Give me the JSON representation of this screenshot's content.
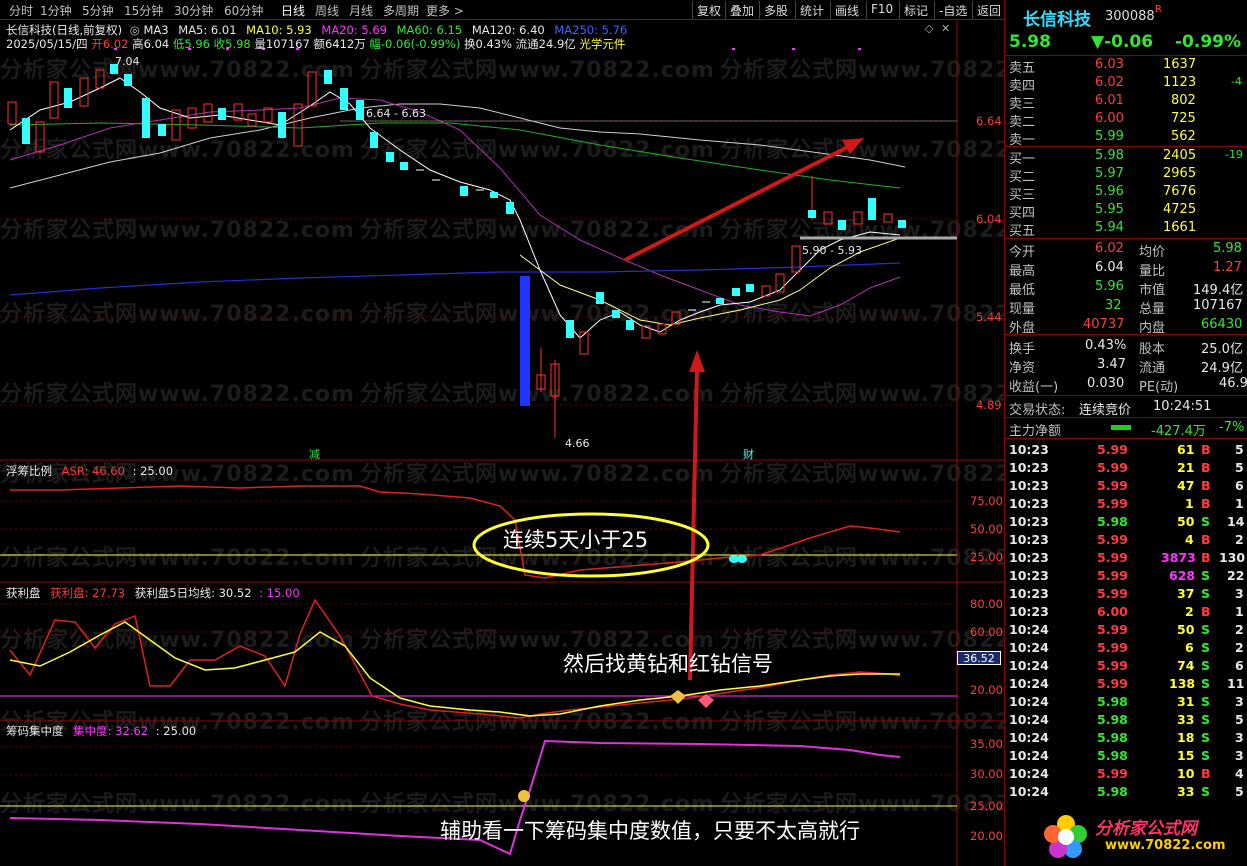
{
  "toolbar": {
    "periods": [
      "分时",
      "1分钟",
      "5分钟",
      "15分钟",
      "30分钟",
      "60分钟",
      "日线",
      "周线",
      "月线",
      "多周期",
      "更多 >"
    ],
    "buttons": [
      "复权",
      "叠加",
      "多股",
      "统计",
      "画线",
      "F10",
      "标记",
      "-自选",
      "返回"
    ]
  },
  "info": {
    "title": "长信科技(日线,前复权)",
    "ma3": "MA3",
    "ma5": "MA5: 6.01",
    "ma10": "MA10: 5.93",
    "ma20": "MA20: 5.69",
    "ma60": "MA60: 6.15",
    "ma120": "MA120: 6.40",
    "ma250": "MA250: 5.76",
    "line2_date": "2025/05/15/四",
    "line2_open": "开6.02",
    "line2_high": "高6.04",
    "line2_low": "低5.96",
    "line2_close": "收5.98",
    "line2_vol": "量107167",
    "line2_amt": "额6412万",
    "line2_chg": "幅-0.06(-0.99%)",
    "line2_turn": "换0.43%",
    "line2_float": "流通24.9亿",
    "line2_sector": "光学元件"
  },
  "price_axis": [
    "6.64",
    "6.04",
    "5.44",
    "4.89"
  ],
  "price_labels": {
    "high": "7.04",
    "low": "4.66",
    "box_top": "6.64 - 6.63",
    "box_right": "5.90 - 5.93",
    "marker_minus": "减",
    "marker_cai": "财"
  },
  "indicator1": {
    "name": "浮筹比例",
    "asr": "ASR: 46.60",
    "line": ": 25.00",
    "axis": [
      "75.00",
      "50.00",
      "25.00"
    ]
  },
  "indicator2": {
    "name": "获利盘",
    "a": "获利盘: 27.73",
    "b": "获利盘5日均线: 30.52",
    "c": ": 15.00",
    "axis": [
      "80.00",
      "60.00",
      "20.00"
    ],
    "cursor_value": "36.52"
  },
  "indicator3": {
    "name": "筹码集中度",
    "a": "集中度: 32.62",
    "b": ": 25.00",
    "axis": [
      "35.00",
      "30.00",
      "25.00",
      "20.00"
    ]
  },
  "annotations": {
    "ellipse_text": "连续5天小于25",
    "signal_text": "然后找黄钻和红钻信号",
    "bottom_text": "辅助看一下筹码集中度数值，只要不太高就行"
  },
  "watermark": "分析家公式网www.70822.com",
  "logo": {
    "name": "分析家公式网",
    "url": "www.70822.com"
  },
  "quote": {
    "name": "长信科技",
    "code": "300088",
    "badge": "R",
    "price": "5.98",
    "change": "▼-0.06",
    "pct": "-0.99%",
    "asks": [
      {
        "label": "卖五",
        "price": "6.03",
        "vol": "1637",
        "delta": ""
      },
      {
        "label": "卖四",
        "price": "6.02",
        "vol": "1123",
        "delta": "-4"
      },
      {
        "label": "卖三",
        "price": "6.01",
        "vol": "802",
        "delta": ""
      },
      {
        "label": "卖二",
        "price": "6.00",
        "vol": "725",
        "delta": ""
      },
      {
        "label": "卖一",
        "price": "5.99",
        "vol": "562",
        "delta": ""
      }
    ],
    "bids": [
      {
        "label": "买一",
        "price": "5.98",
        "vol": "2405",
        "delta": "-19"
      },
      {
        "label": "买二",
        "price": "5.97",
        "vol": "2965",
        "delta": ""
      },
      {
        "label": "买三",
        "price": "5.96",
        "vol": "7676",
        "delta": ""
      },
      {
        "label": "买四",
        "price": "5.95",
        "vol": "4725",
        "delta": ""
      },
      {
        "label": "买五",
        "price": "5.94",
        "vol": "1661",
        "delta": ""
      }
    ],
    "stats": [
      {
        "k1": "今开",
        "v1": "6.02",
        "k2": "均价",
        "v2": "5.98",
        "c1": "red",
        "c2": "green"
      },
      {
        "k1": "最高",
        "v1": "6.04",
        "k2": "量比",
        "v2": "1.27",
        "c1": "white",
        "c2": "red"
      },
      {
        "k1": "最低",
        "v1": "5.96",
        "k2": "市值",
        "v2": "149.4亿",
        "c1": "green",
        "c2": "white"
      },
      {
        "k1": "现量",
        "v1": "32",
        "k2": "总量",
        "v2": "107167",
        "c1": "green",
        "c2": "white"
      },
      {
        "k1": "外盘",
        "v1": "40737",
        "k2": "内盘",
        "v2": "66430",
        "c1": "red",
        "c2": "green"
      }
    ],
    "stats2": [
      {
        "k1": "换手",
        "v1": "0.43%",
        "k2": "股本",
        "v2": "25.0亿"
      },
      {
        "k1": "净资",
        "v1": "3.47",
        "k2": "流通",
        "v2": "24.9亿"
      },
      {
        "k1": "收益(一)",
        "v1": "0.030",
        "k2": "PE(动)",
        "v2": "46.9"
      }
    ],
    "trade_state_label": "交易状态:",
    "trade_state": "连续竞价",
    "trade_time": "10:24:51",
    "flow_label": "主力净额",
    "flow_value": "-427.4万",
    "flow_pct": "-7%"
  },
  "ticks": [
    {
      "t": "10:23",
      "p": "5.99",
      "v": "61",
      "s": "B",
      "n": "5"
    },
    {
      "t": "10:23",
      "p": "5.99",
      "v": "21",
      "s": "B",
      "n": "5"
    },
    {
      "t": "10:23",
      "p": "5.99",
      "v": "47",
      "s": "B",
      "n": "6"
    },
    {
      "t": "10:23",
      "p": "5.99",
      "v": "1",
      "s": "B",
      "n": "1"
    },
    {
      "t": "10:23",
      "p": "5.98",
      "v": "50",
      "s": "S",
      "n": "14"
    },
    {
      "t": "10:23",
      "p": "5.99",
      "v": "4",
      "s": "B",
      "n": "2"
    },
    {
      "t": "10:23",
      "p": "5.99",
      "v": "3873",
      "s": "B",
      "n": "130"
    },
    {
      "t": "10:23",
      "p": "5.99",
      "v": "628",
      "s": "S",
      "n": "22"
    },
    {
      "t": "10:23",
      "p": "5.99",
      "v": "37",
      "s": "S",
      "n": "3"
    },
    {
      "t": "10:23",
      "p": "6.00",
      "v": "2",
      "s": "B",
      "n": "1"
    },
    {
      "t": "10:24",
      "p": "5.99",
      "v": "50",
      "s": "S",
      "n": "2"
    },
    {
      "t": "10:24",
      "p": "5.99",
      "v": "6",
      "s": "S",
      "n": "2"
    },
    {
      "t": "10:24",
      "p": "5.99",
      "v": "74",
      "s": "S",
      "n": "6"
    },
    {
      "t": "10:24",
      "p": "5.99",
      "v": "138",
      "s": "S",
      "n": "11"
    },
    {
      "t": "10:24",
      "p": "5.98",
      "v": "31",
      "s": "S",
      "n": "3"
    },
    {
      "t": "10:24",
      "p": "5.98",
      "v": "33",
      "s": "S",
      "n": "5"
    },
    {
      "t": "10:24",
      "p": "5.98",
      "v": "18",
      "s": "S",
      "n": "3"
    },
    {
      "t": "10:24",
      "p": "5.98",
      "v": "15",
      "s": "S",
      "n": "3"
    },
    {
      "t": "10:24",
      "p": "5.99",
      "v": "10",
      "s": "B",
      "n": "4"
    },
    {
      "t": "10:24",
      "p": "5.98",
      "v": "33",
      "s": "S",
      "n": "5"
    }
  ]
}
